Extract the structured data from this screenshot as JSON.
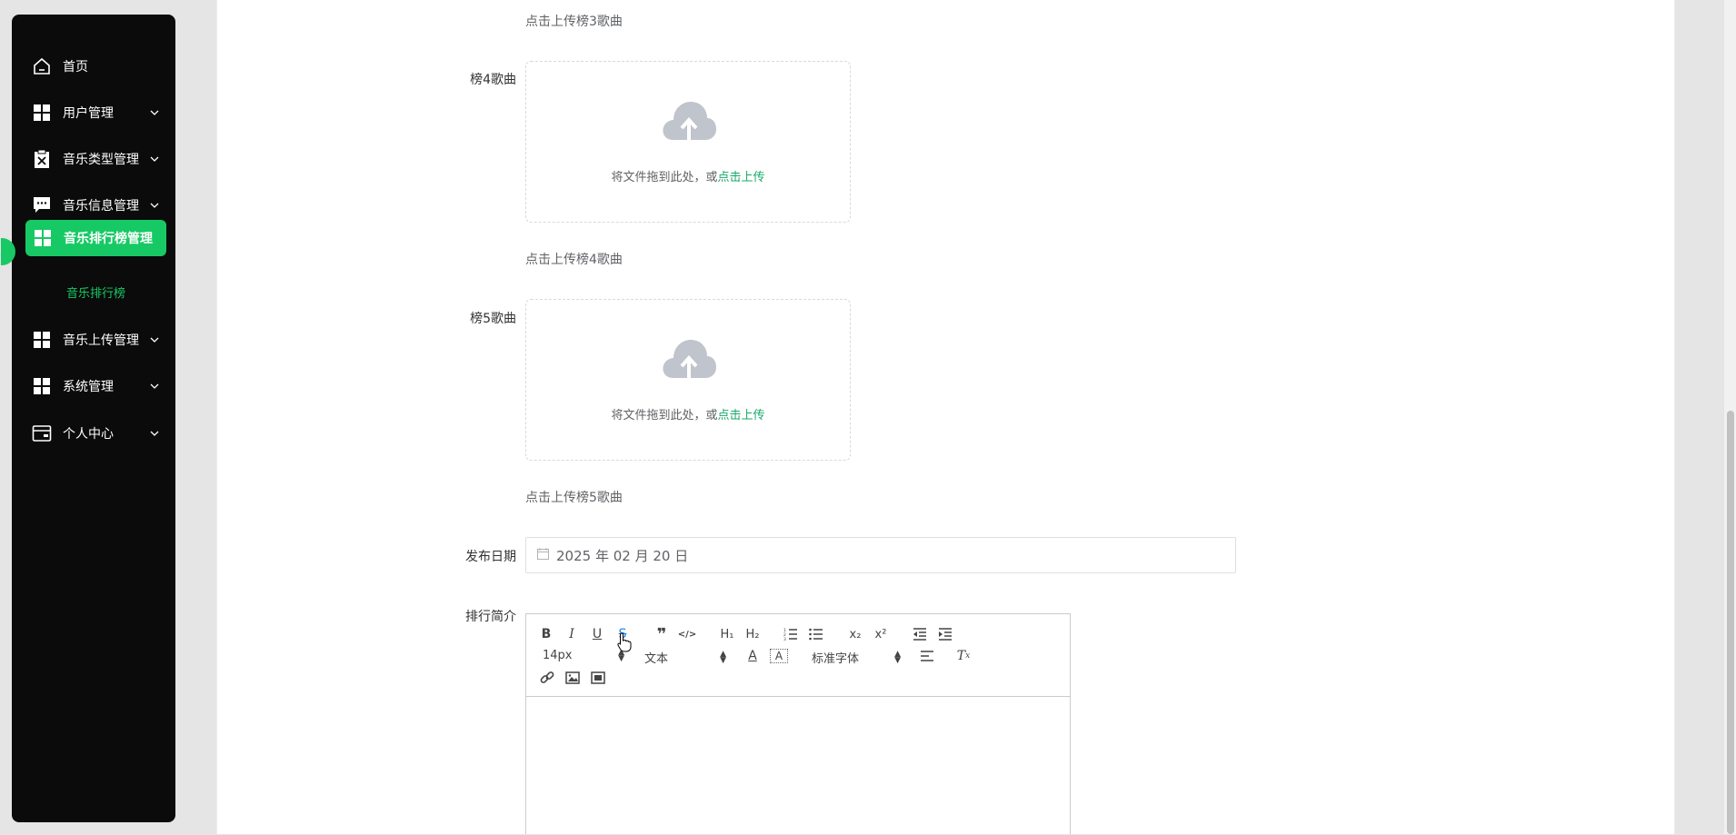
{
  "sidebar": {
    "items": [
      {
        "label": "首页",
        "icon": "home-icon"
      },
      {
        "label": "用户管理",
        "icon": "grid-icon"
      },
      {
        "label": "音乐类型管理",
        "icon": "clipboard-x-icon"
      },
      {
        "label": "音乐信息管理",
        "icon": "message-icon"
      },
      {
        "label": "音乐排行榜管理",
        "icon": "grid-icon"
      },
      {
        "label": "音乐上传管理",
        "icon": "grid-icon"
      },
      {
        "label": "系统管理",
        "icon": "grid-icon"
      },
      {
        "label": "个人中心",
        "icon": "wallet-icon"
      }
    ],
    "submenu": {
      "label": "音乐排行榜"
    }
  },
  "form": {
    "hint3": "点击上传榜3歌曲",
    "field4": {
      "label": "榜4歌曲",
      "upload_text": "将文件拖到此处，或",
      "upload_link": "点击上传",
      "hint": "点击上传榜4歌曲"
    },
    "field5": {
      "label": "榜5歌曲",
      "upload_text": "将文件拖到此处，或",
      "upload_link": "点击上传",
      "hint": "点击上传榜5歌曲"
    },
    "date": {
      "label": "发布日期",
      "value": "2025 年 02 月 20 日"
    },
    "intro": {
      "label": "排行简介"
    }
  },
  "editor": {
    "font_size": "14px",
    "paragraph": "文本",
    "font_family": "标准字体"
  },
  "colors": {
    "accent": "#17c964",
    "link": "#17a86a",
    "sidebar_bg": "#0b0b0b"
  }
}
